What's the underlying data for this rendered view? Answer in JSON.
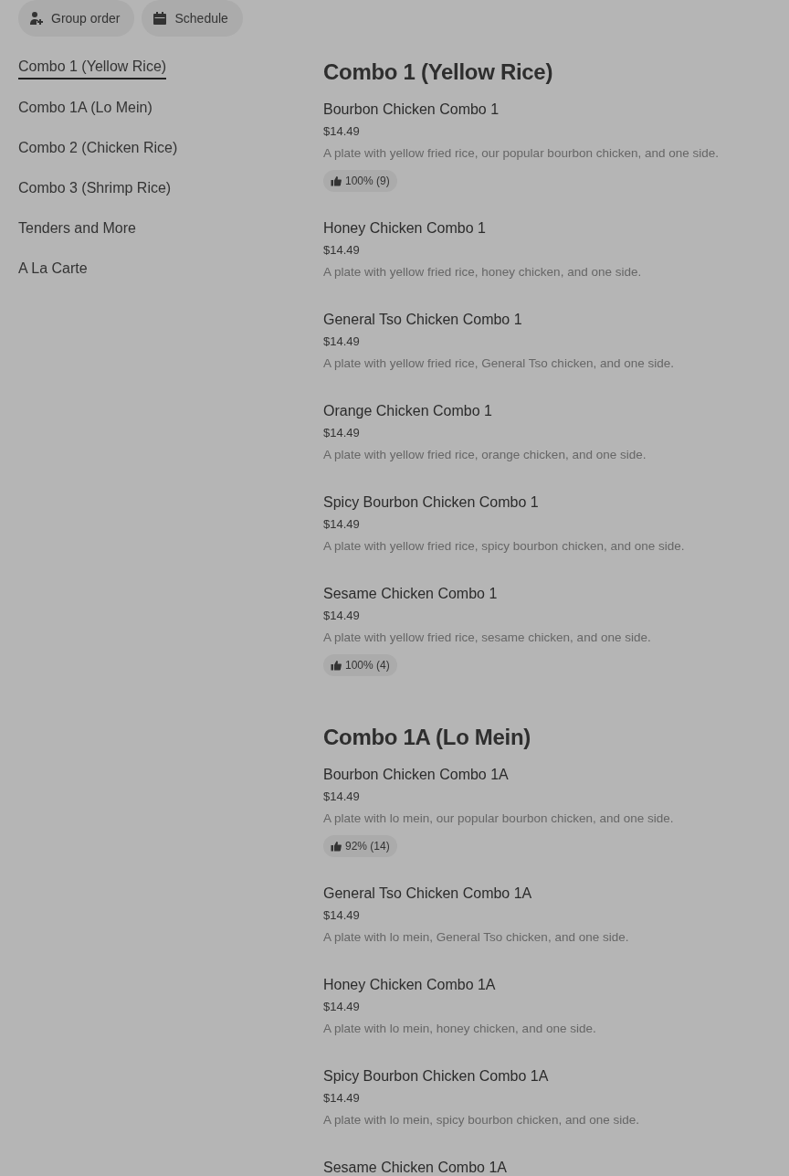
{
  "toolbar": {
    "buttons": [
      {
        "kind": "group",
        "label": "Group order"
      },
      {
        "kind": "schedule",
        "label": "Schedule"
      }
    ]
  },
  "sidebar": {
    "items": [
      {
        "label": "Combo 1 (Yellow Rice)",
        "selected": true
      },
      {
        "label": "Combo 1A (Lo Mein)",
        "selected": false
      },
      {
        "label": "Combo 2 (Chicken Rice)",
        "selected": false
      },
      {
        "label": "Combo 3 (Shrimp Rice)",
        "selected": false
      },
      {
        "label": "Tenders and More",
        "selected": false
      },
      {
        "label": "A La Carte",
        "selected": false
      }
    ]
  },
  "sections": [
    {
      "title": "Combo 1 (Yellow Rice)",
      "items": [
        {
          "name": "Bourbon Chicken Combo 1",
          "price": "$14.49",
          "description": "A plate with yellow fried rice, our popular bourbon chicken, and one side.",
          "rating": "100% (9)"
        },
        {
          "name": "Honey Chicken Combo 1",
          "price": "$14.49",
          "description": "A plate with yellow fried rice, honey chicken, and one side."
        },
        {
          "name": "General Tso Chicken Combo 1",
          "price": "$14.49",
          "description": "A plate with yellow fried rice, General Tso chicken, and one side."
        },
        {
          "name": "Orange Chicken Combo 1",
          "price": "$14.49",
          "description": "A plate with yellow fried rice, orange chicken, and one side."
        },
        {
          "name": "Spicy Bourbon Chicken Combo 1",
          "price": "$14.49",
          "description": "A plate with yellow fried rice, spicy bourbon chicken, and one side."
        },
        {
          "name": "Sesame Chicken Combo 1",
          "price": "$14.49",
          "description": "A plate with yellow fried rice, sesame chicken, and one side.",
          "rating": "100% (4)"
        }
      ]
    },
    {
      "title": "Combo 1A (Lo Mein)",
      "items": [
        {
          "name": "Bourbon Chicken Combo 1A",
          "price": "$14.49",
          "description": "A plate with lo mein, our popular bourbon chicken, and one side.",
          "rating": "92% (14)"
        },
        {
          "name": "General Tso Chicken Combo 1A",
          "price": "$14.49",
          "description": "A plate with lo mein, General Tso chicken, and one side."
        },
        {
          "name": "Honey Chicken Combo 1A",
          "price": "$14.49",
          "description": "A plate with lo mein, honey chicken, and one side."
        },
        {
          "name": "Spicy Bourbon Chicken Combo 1A",
          "price": "$14.49",
          "description": "A plate with lo mein, spicy bourbon chicken, and one side."
        },
        {
          "name": "Sesame Chicken Combo 1A"
        }
      ]
    }
  ]
}
